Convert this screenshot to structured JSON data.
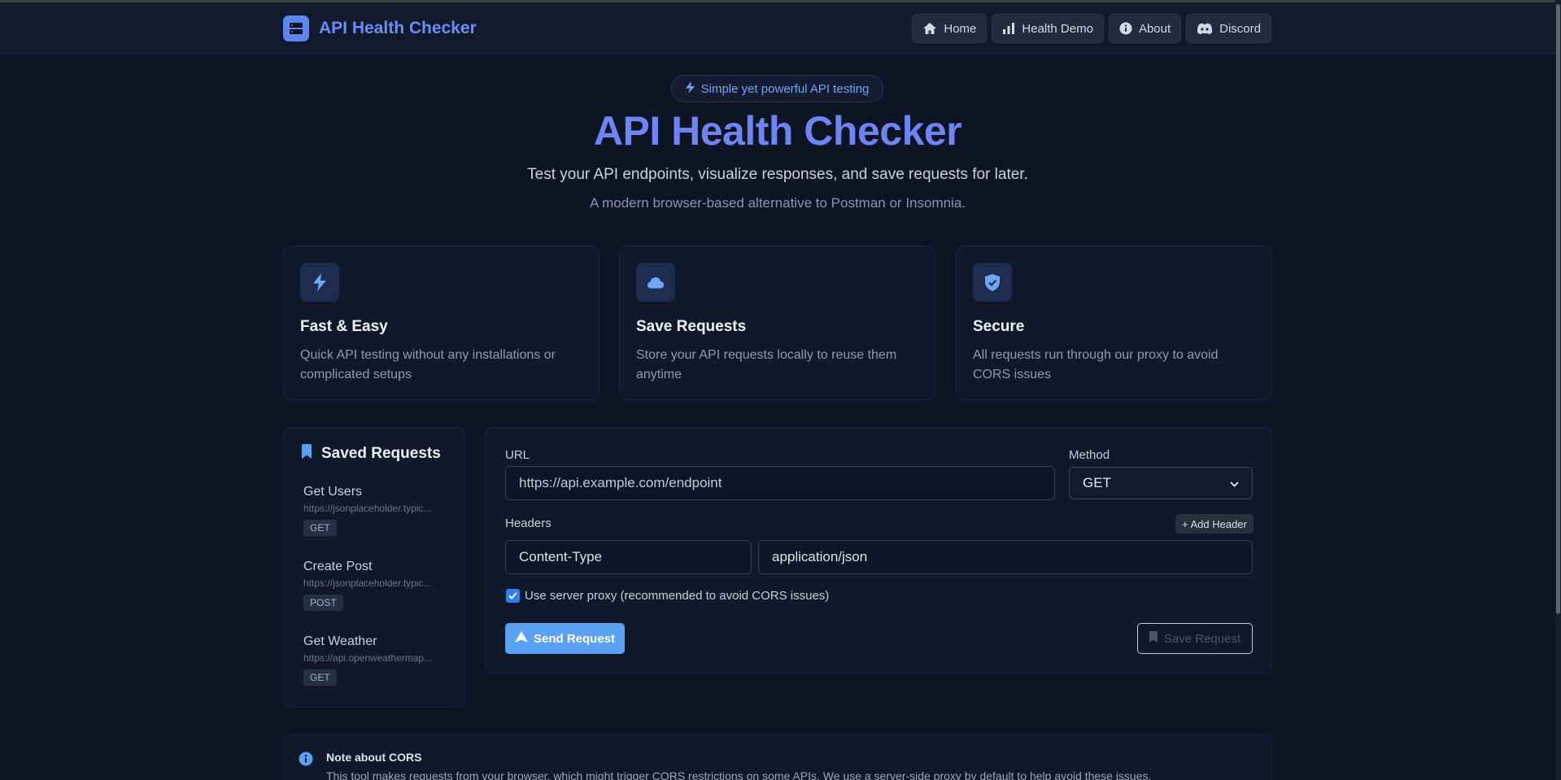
{
  "app": {
    "title": "API Health Checker"
  },
  "nav": {
    "items": [
      {
        "label": "Home",
        "icon": "home-icon"
      },
      {
        "label": "Health Demo",
        "icon": "chart-bar-icon"
      },
      {
        "label": "About",
        "icon": "info-icon"
      },
      {
        "label": "Discord",
        "icon": "discord-icon"
      }
    ]
  },
  "hero": {
    "badge": "Simple yet powerful API testing",
    "title": "API Health Checker",
    "subtitle": "Test your API endpoints, visualize responses, and save requests for later.",
    "tagline": "A modern browser-based alternative to Postman or Insomnia."
  },
  "features": [
    {
      "title": "Fast & Easy",
      "desc_line1": "Quick API testing without any installations or",
      "desc_line2": "complicated setups",
      "icon": "bolt-icon"
    },
    {
      "title": "Save Requests",
      "desc_line1": "Store your API requests locally to reuse them",
      "desc_line2": "anytime",
      "icon": "cloud-icon"
    },
    {
      "title": "Secure",
      "desc_line1": "All requests run through our proxy to avoid",
      "desc_line2": "CORS issues",
      "icon": "shield-icon"
    }
  ],
  "saved": {
    "title": "Saved Requests",
    "items": [
      {
        "name": "Get Users",
        "url": "https://jsonplaceholder.typic...",
        "method": "GET"
      },
      {
        "name": "Create Post",
        "url": "https://jsonplaceholder.typic...",
        "method": "POST"
      },
      {
        "name": "Get Weather",
        "url": "https://api.openweathermap...",
        "method": "GET"
      }
    ]
  },
  "form": {
    "url_label": "URL",
    "url_placeholder": "https://api.example.com/endpoint",
    "method_label": "Method",
    "method_value": "GET",
    "headers_label": "Headers",
    "add_header": "+ Add Header",
    "header_key": "Content-Type",
    "header_value": "application/json",
    "proxy_label": "Use server proxy (recommended to avoid CORS issues)",
    "proxy_checked": true,
    "send_label": "Send Request",
    "save_label": "Save Request"
  },
  "note": {
    "title": "Note about CORS",
    "text": "This tool makes requests from your browser, which might trigger CORS restrictions on some APIs. We use a server-side proxy by default to help avoid these issues."
  },
  "colors": {
    "background": "#0d1424",
    "accent": "#6f84f3",
    "primary_button": "#5aa0f3"
  }
}
